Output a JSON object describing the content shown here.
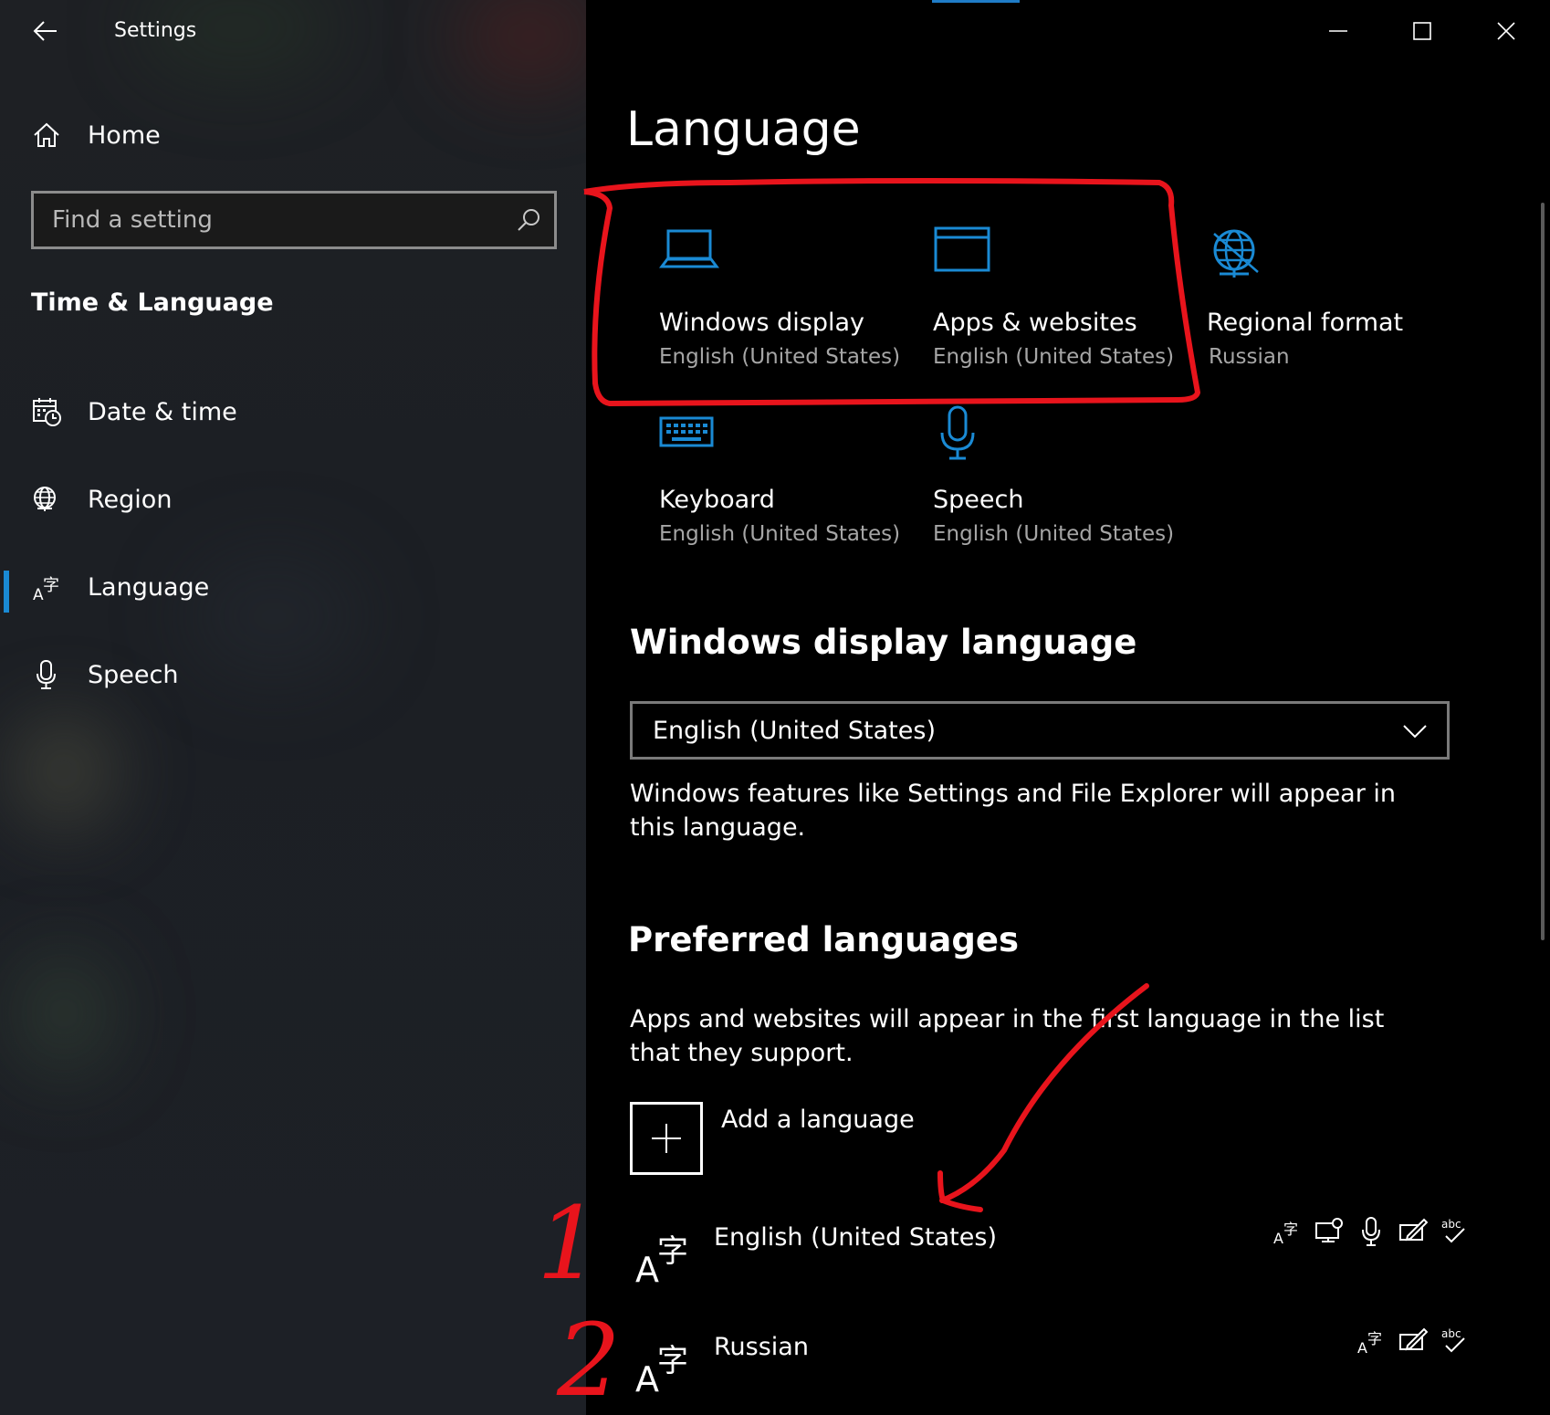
{
  "window": {
    "title": "Settings"
  },
  "sidebar": {
    "home_label": "Home",
    "search_placeholder": "Find a setting",
    "section_title": "Time & Language",
    "items": [
      {
        "label": "Date & time",
        "icon": "calendar-clock-icon"
      },
      {
        "label": "Region",
        "icon": "globe-icon"
      },
      {
        "label": "Language",
        "icon": "language-icon",
        "selected": true
      },
      {
        "label": "Speech",
        "icon": "microphone-icon"
      }
    ]
  },
  "main": {
    "title": "Language",
    "tiles": [
      {
        "label": "Windows display",
        "sub": "English (United States)",
        "icon": "laptop-icon"
      },
      {
        "label": "Apps & websites",
        "sub": "English (United States)",
        "icon": "window-icon"
      },
      {
        "label": "Regional format",
        "sub": "Russian",
        "icon": "globe-icon"
      },
      {
        "label": "Keyboard",
        "sub": "English (United States)",
        "icon": "keyboard-icon"
      },
      {
        "label": "Speech",
        "sub": "English (United States)",
        "icon": "microphone-icon"
      }
    ],
    "display_language": {
      "heading": "Windows display language",
      "selected": "English (United States)",
      "description": "Windows features like Settings and File Explorer will appear in this language."
    },
    "preferred": {
      "heading": "Preferred languages",
      "description": "Apps and websites will appear in the first language in the list that they support.",
      "add_label": "Add a language",
      "languages": [
        {
          "name": "English (United States)",
          "features": [
            "display-language-icon",
            "text-to-speech-icon",
            "speech-recognition-icon",
            "handwriting-icon",
            "spell-check-icon"
          ]
        },
        {
          "name": "Russian",
          "features": [
            "display-language-icon",
            "handwriting-icon",
            "spell-check-icon"
          ]
        }
      ]
    }
  },
  "annotations": {
    "numbers": [
      "1",
      "2"
    ],
    "color": "#e8141c"
  },
  "colors": {
    "accent": "#1f7cc7",
    "icon_blue": "#1a8ad4",
    "annotation_red": "#e8141c"
  }
}
